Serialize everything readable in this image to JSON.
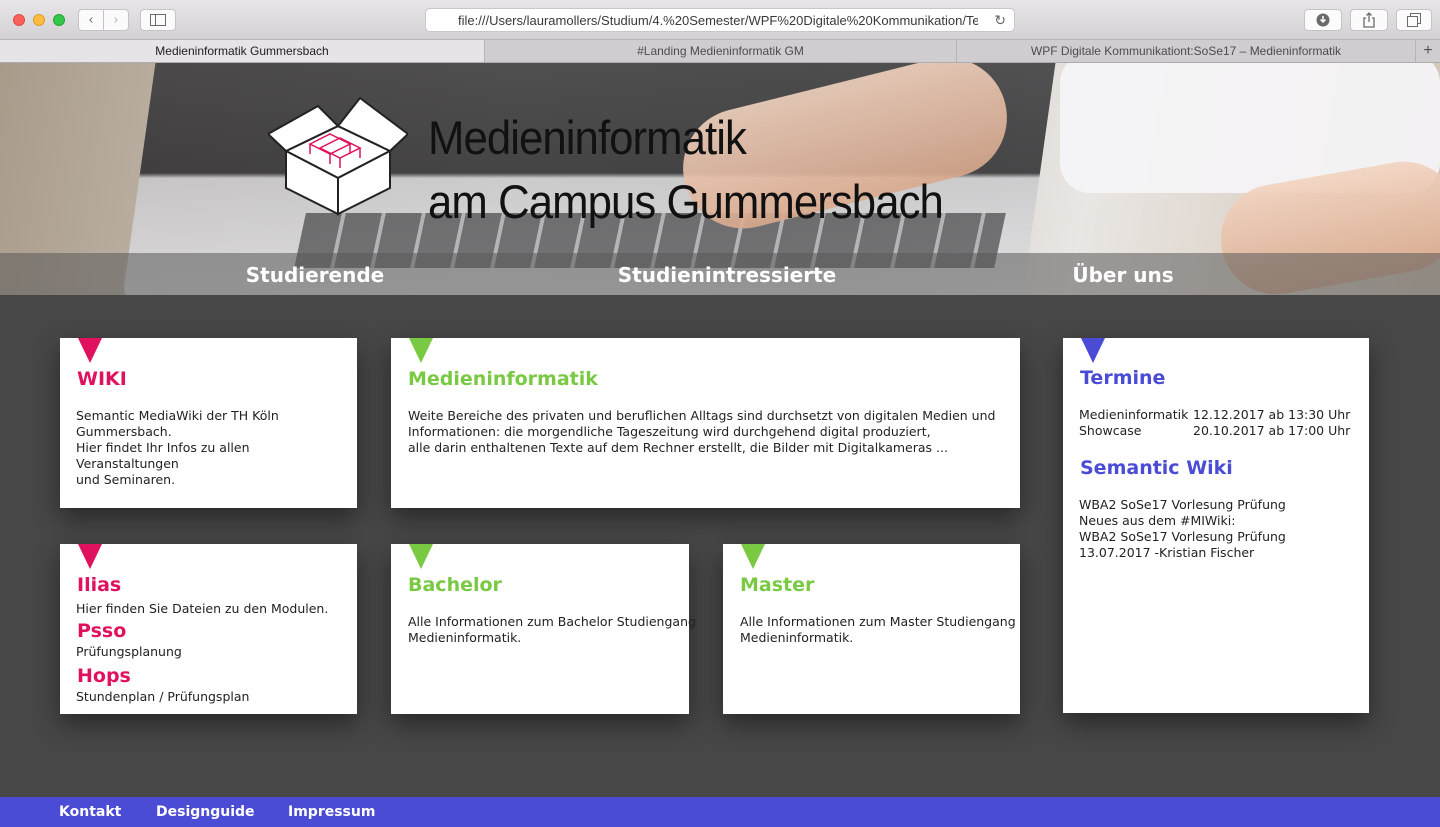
{
  "browser": {
    "url": "file:///Users/lauramollers/Studium/4.%20Semester/WPF%20Digitale%20Kommunikation/Tean",
    "tabs": [
      {
        "label": "Medieninformatik Gummersbach",
        "active": true
      },
      {
        "label": "#Landing Medieninformatik GM",
        "active": false
      },
      {
        "label": "WPF Digitale Kommunikationt:SoSe17 – Medieninformatik",
        "active": false
      }
    ]
  },
  "hero": {
    "title_line1": "Medieninformatik",
    "title_line2": "am Campus Gummersbach"
  },
  "nav": {
    "students": "Studierende",
    "prospective": "Studienintressierte",
    "about": "Über uns"
  },
  "cards": {
    "wiki": {
      "title": "WIKI",
      "text_line1": "Semantic MediaWiki der TH Köln",
      "text_line2": "Gummersbach.",
      "text_line3": "Hier findet Ihr Infos zu allen Veranstaltungen",
      "text_line4": "und Seminaren."
    },
    "medieninformatik": {
      "title": "Medieninformatik",
      "text_line1": "Weite Bereiche des privaten und beruflichen Alltags sind durchsetzt von digitalen Medien und",
      "text_line2": "Informationen: die morgendliche Tageszeitung wird durchgehend digital produziert,",
      "text_line3": "alle darin enthaltenen Texte auf dem Rechner erstellt, die Bilder mit Digitalkameras ..."
    },
    "ilias": {
      "title": "Ilias",
      "text": "Hier finden Sie Dateien zu den Modulen.",
      "psso_title": "Psso",
      "psso_text": "Prüfungsplanung",
      "hops_title": "Hops",
      "hops_text": "Stundenplan / Prüfungsplan"
    },
    "bachelor": {
      "title": "Bachelor",
      "text_line1": "Alle Informationen zum Bachelor Studiengang",
      "text_line2": "Medieninformatik."
    },
    "master": {
      "title": "Master",
      "text_line1": "Alle Informationen zum Master Studiengang",
      "text_line2": "Medieninformatik."
    },
    "termine": {
      "title": "Termine",
      "rows": [
        {
          "name": "Medieninformatik",
          "date": "12.12.2017 ab 13:30 Uhr"
        },
        {
          "name": "Showcase",
          "date": "20.10.2017 ab 17:00 Uhr"
        }
      ],
      "semantic_title": "Semantic Wiki",
      "semantic_line1": "WBA2 SoSe17 Vorlesung Prüfung",
      "semantic_line2": "Neues aus dem #MIWiki:",
      "semantic_line3": "WBA2 SoSe17 Vorlesung Prüfung",
      "semantic_line4": "13.07.2017 -Kristian Fischer"
    }
  },
  "footer": {
    "contact": "Kontakt",
    "designguide": "Designguide",
    "imprint": "Impressum"
  },
  "colors": {
    "pink": "#e0115f",
    "green": "#7ac943",
    "blue": "#4a4cd6",
    "background": "#474747"
  }
}
